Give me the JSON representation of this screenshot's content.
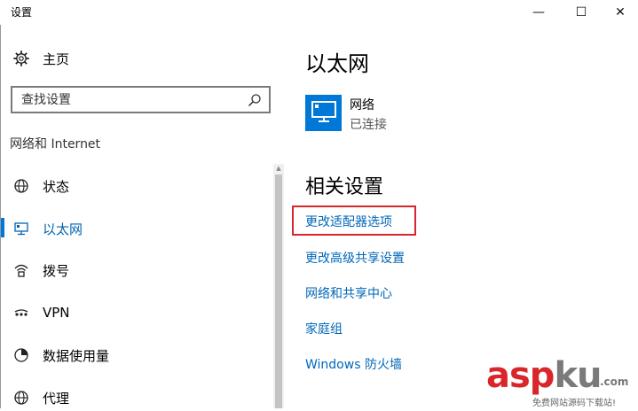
{
  "window": {
    "title": "设置",
    "minimize": "—",
    "maximize": "☐",
    "close": "✕"
  },
  "sidebar": {
    "home": {
      "label": "主页",
      "icon": "gear-icon"
    },
    "search": {
      "placeholder": "查找设置",
      "icon": "search-icon"
    },
    "section_title": "网络和 Internet",
    "items": [
      {
        "label": "状态",
        "icon": "globe-icon",
        "active": false
      },
      {
        "label": "以太网",
        "icon": "ethernet-icon",
        "active": true
      },
      {
        "label": "拨号",
        "icon": "dialup-icon",
        "active": false
      },
      {
        "label": "VPN",
        "icon": "vpn-icon",
        "active": false
      },
      {
        "label": "数据使用量",
        "icon": "data-usage-icon",
        "active": false
      },
      {
        "label": "代理",
        "icon": "proxy-globe-icon",
        "active": false
      }
    ]
  },
  "main": {
    "title": "以太网",
    "network": {
      "name": "网络",
      "status": "已连接",
      "icon": "monitor-icon"
    },
    "related_title": "相关设置",
    "links": [
      "更改适配器选项",
      "更改高级共享设置",
      "网络和共享中心",
      "家庭组",
      "Windows 防火墙"
    ]
  },
  "watermark": {
    "brand_a": "asp",
    "brand_b": "ku",
    "suffix": ".com",
    "tagline": "免费网站源码下载站!"
  },
  "colors": {
    "accent": "#0078d7",
    "link": "#0067b8",
    "highlight": "#d9262b"
  }
}
